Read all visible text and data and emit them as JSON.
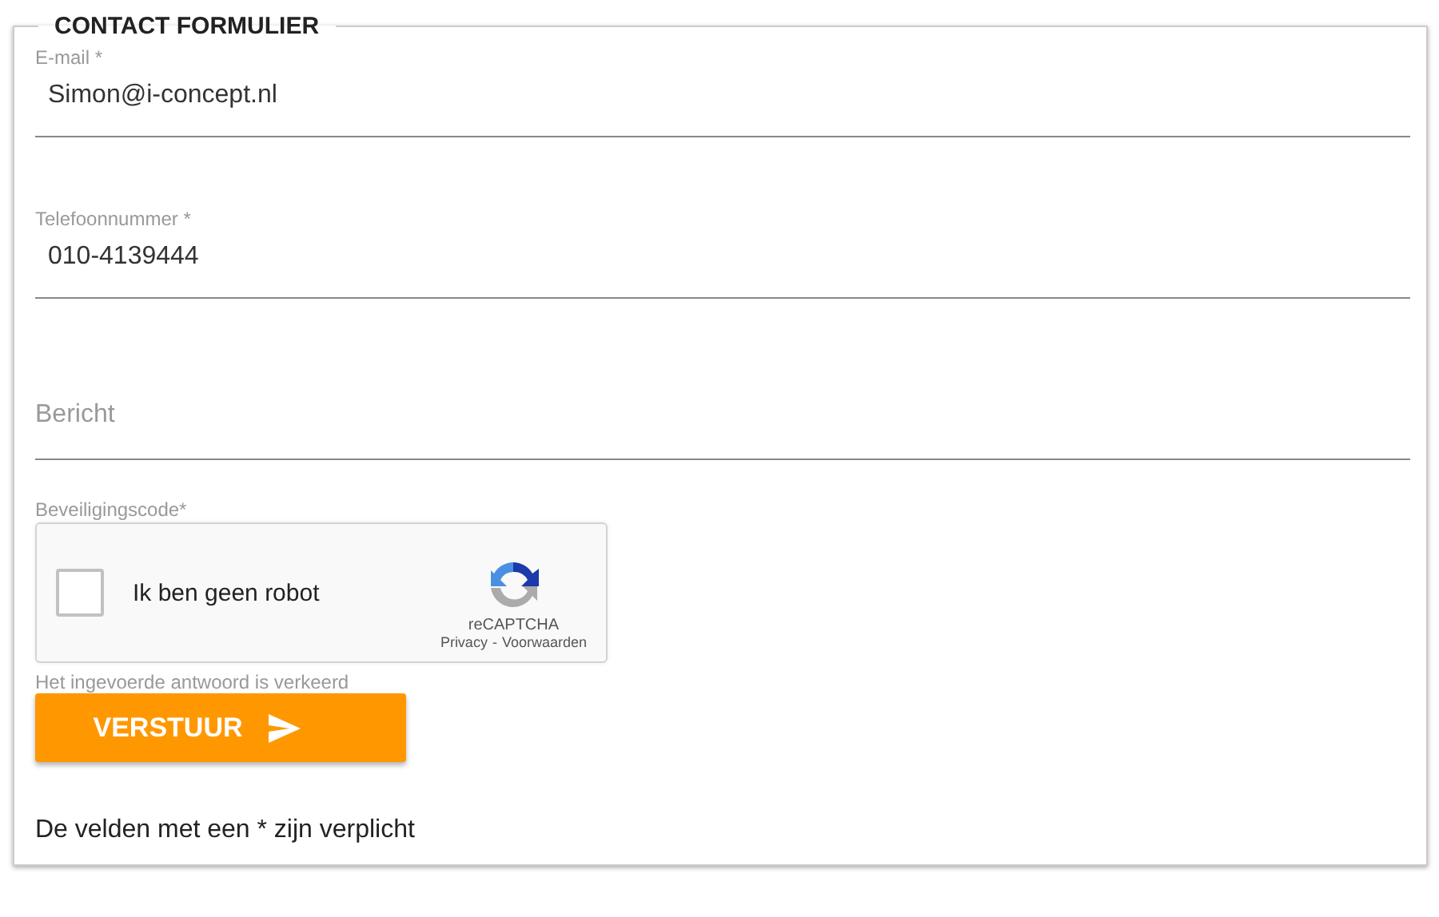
{
  "form": {
    "title": "CONTACT FORMULIER",
    "fields": [
      {
        "label": "E-mail *",
        "value": "Simon@i-concept.nl"
      },
      {
        "label": "Telefoonnummer *",
        "value": "010-4139444"
      },
      {
        "placeholder": "Bericht"
      }
    ],
    "captcha": {
      "label": "Beveiligingscode*",
      "checked": false,
      "text": "Ik ben geen robot",
      "brand": "reCAPTCHA",
      "links": [
        "Privacy",
        "Voorwaarden"
      ],
      "separator": "-",
      "error": "Het ingevoerde antwoord is verkeerd"
    },
    "submit": "VERSTUUR",
    "footnote": "De velden met een * zijn verplicht"
  }
}
